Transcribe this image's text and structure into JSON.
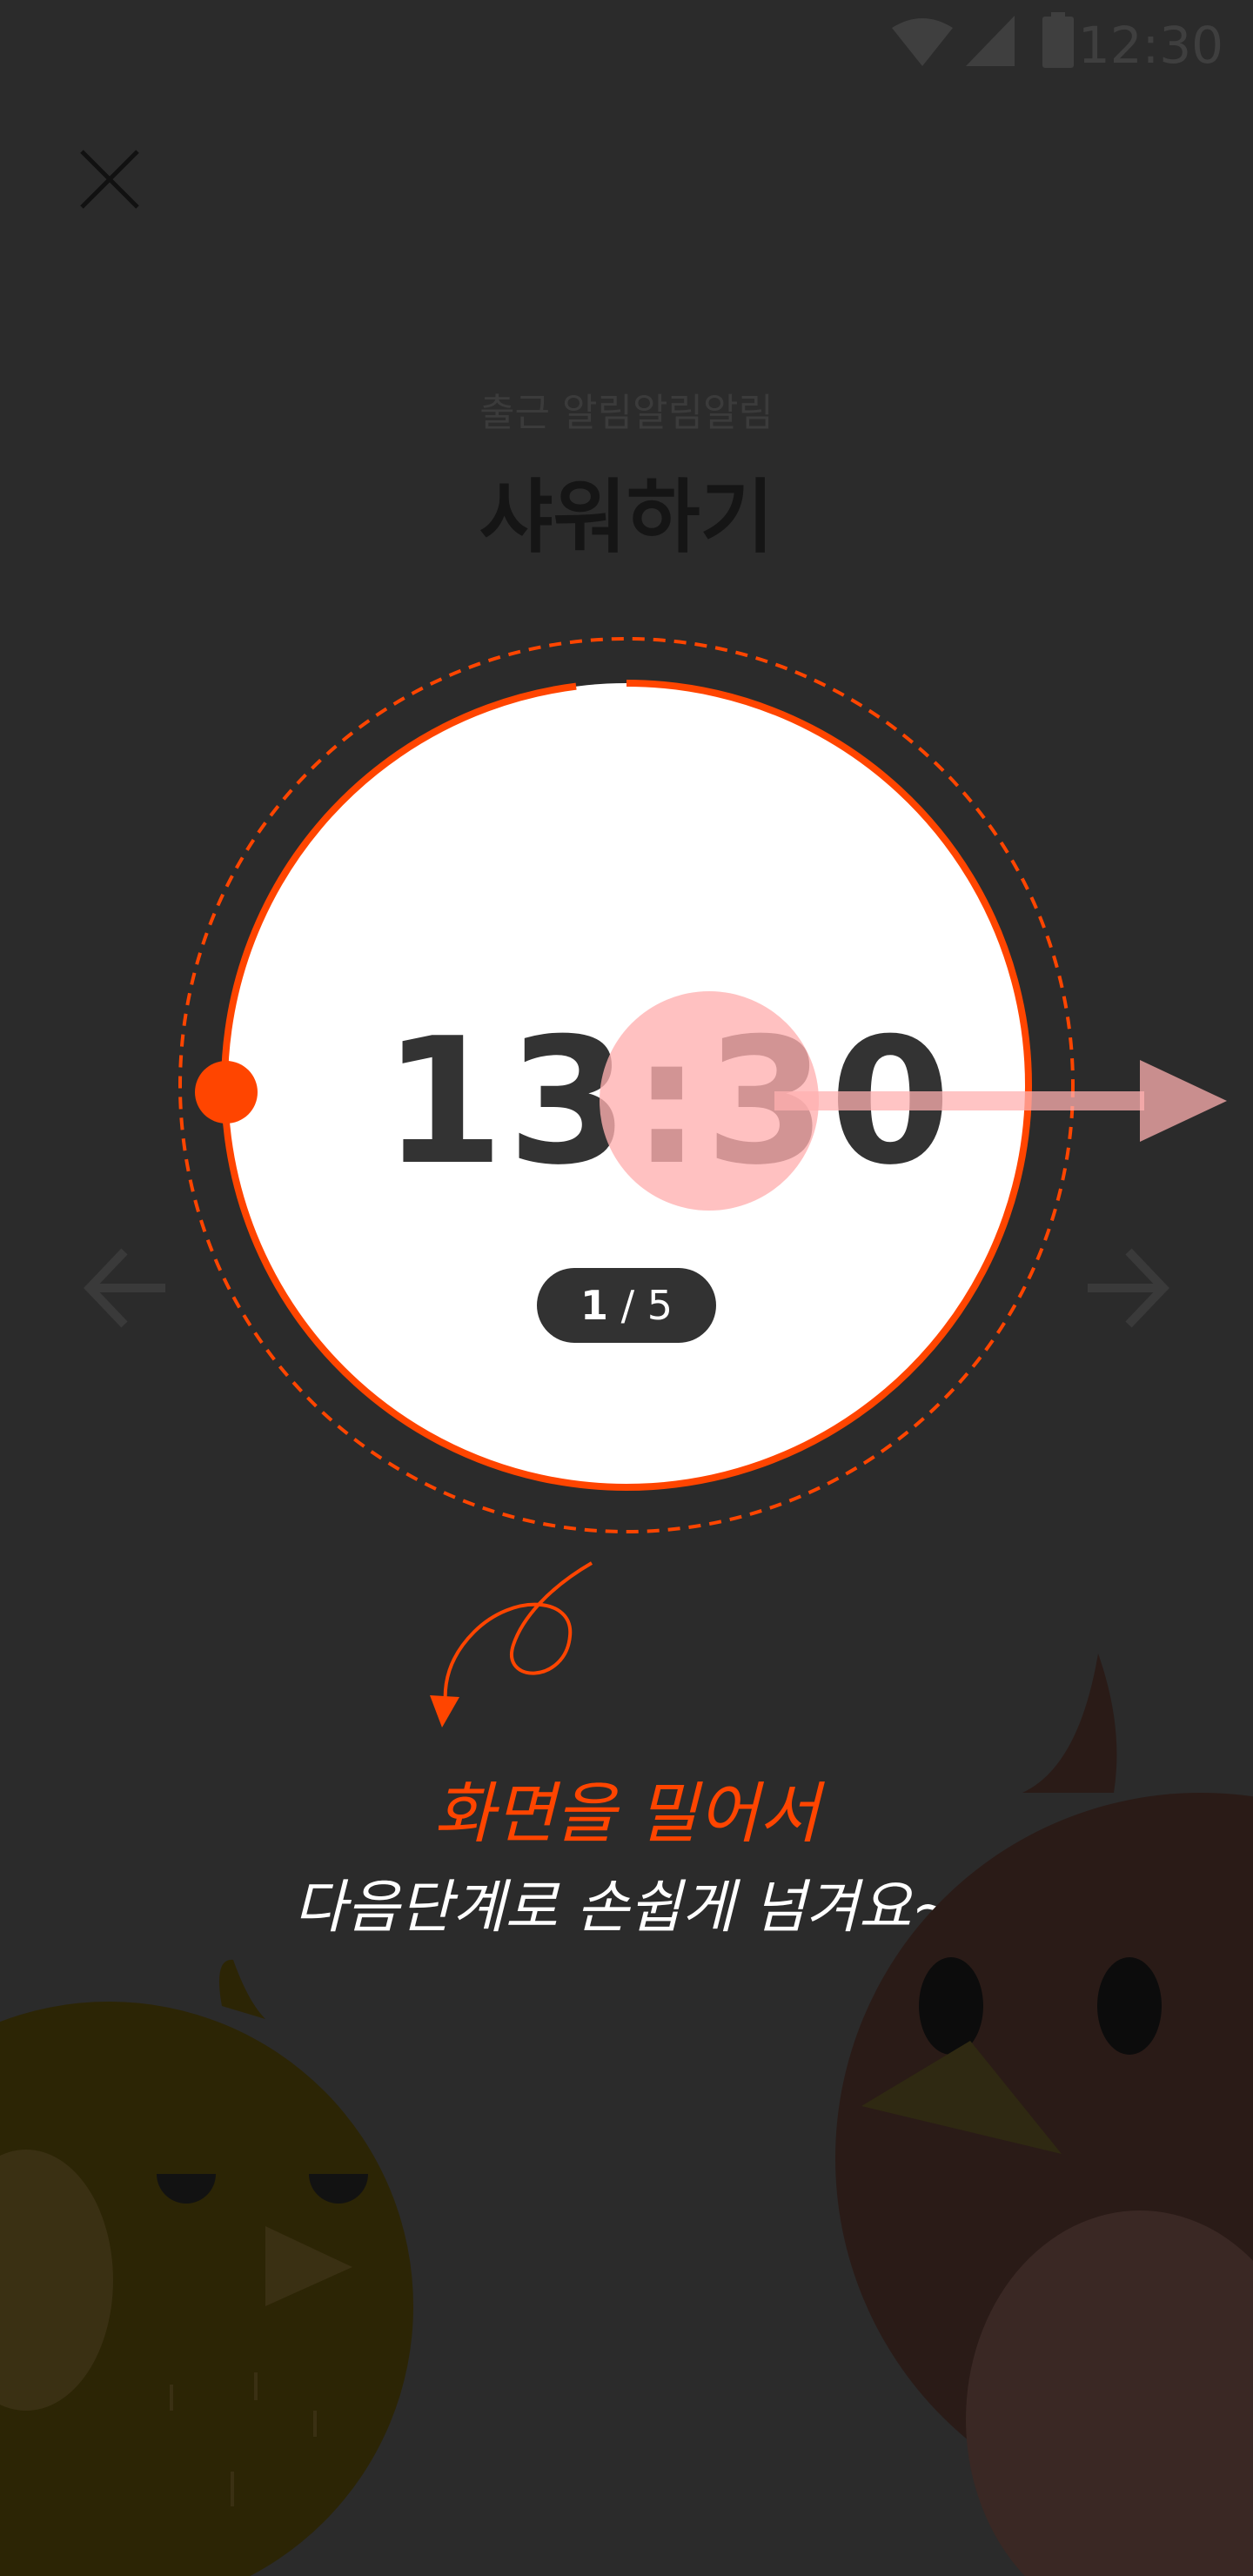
{
  "status_bar": {
    "time": "12:30",
    "icons": [
      "wifi-icon",
      "cellular-signal-icon",
      "battery-icon"
    ]
  },
  "header": {
    "close_icon": "close-icon",
    "subtitle": "출근 알림알림알림",
    "title": "샤워하기"
  },
  "timer": {
    "time": "13:30",
    "step_current": "1",
    "step_separator": " / ",
    "step_total": "5",
    "progress_fraction": 0.98
  },
  "nav": {
    "prev_icon": "arrow-left-icon",
    "next_icon": "arrow-right-icon"
  },
  "hint": {
    "line1": "화면을 밀어서",
    "line2": "다음단계로 손쉽게 넘겨요~",
    "swipe_icon": "swipe-right-icon"
  },
  "colors": {
    "background": "#2b2b2b",
    "accent": "#ff4500",
    "timer_face": "#ffffff",
    "badge": "#323232"
  }
}
